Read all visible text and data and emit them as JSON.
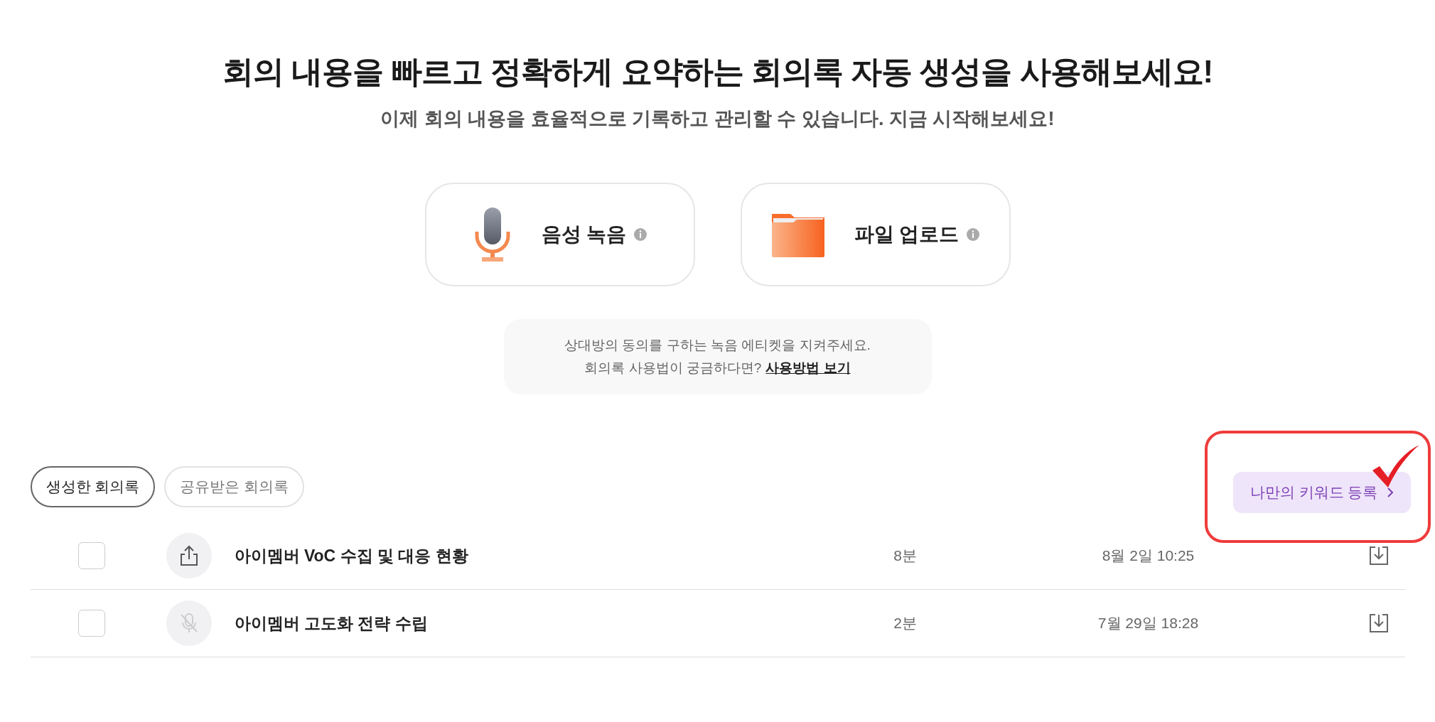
{
  "header": {
    "title": "회의 내용을 빠르고 정확하게 요약하는 회의록 자동 생성을 사용해보세요!",
    "subtitle": "이제 회의 내용을 효율적으로 기록하고 관리할 수 있습니다. 지금 시작해보세요!"
  },
  "actions": [
    {
      "kind": "record",
      "label": "음성 녹음"
    },
    {
      "kind": "upload",
      "label": "파일 업로드"
    }
  ],
  "notice": {
    "line_1": "상대방의 동의를 구하는 녹음 에티켓을 지켜주세요.",
    "line_2": "회의록 사용법이 궁금하다면?",
    "link": "사용방법 보기"
  },
  "tabs": [
    {
      "label": "생성한 회의록",
      "selected": true
    },
    {
      "label": "공유받은 회의록",
      "selected": false
    }
  ],
  "keyword_button": {
    "label": "나만의 키워드 등록",
    "highlighted": true
  },
  "rows": [
    {
      "checked": false,
      "kind": "shared",
      "title": "아이멤버 VoC 수집 및 대응 현황",
      "duration": "8분",
      "date": "8월 2일 10:25"
    },
    {
      "checked": false,
      "kind": "muted",
      "title": "아이멤버 고도화 전략 수립",
      "duration": "2분",
      "date": "7월 29일 18:28"
    }
  ]
}
